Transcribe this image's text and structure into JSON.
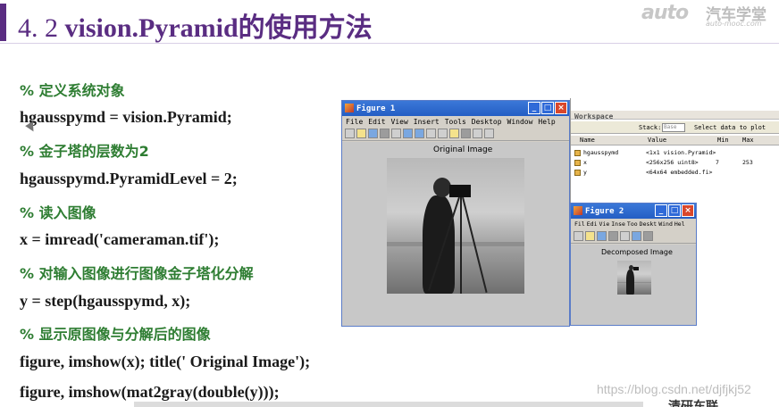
{
  "slide": {
    "title_num": "4. 2",
    "title_text": "vision.Pyramid的使用方法",
    "logo_mark": "auto",
    "logo_cn": "汽车学堂",
    "logo_en": "auto-mooc.com"
  },
  "code": [
    {
      "type": "comment",
      "text": "% 定义系统对象"
    },
    {
      "type": "code",
      "text": "hgausspymd = vision.Pyramid;"
    },
    {
      "type": "comment",
      "text": "% 金子塔的层数为2"
    },
    {
      "type": "code",
      "text": "hgausspymd.PyramidLevel = 2;"
    },
    {
      "type": "comment",
      "text": "% 读入图像"
    },
    {
      "type": "code",
      "text": "x = imread('cameraman.tif');"
    },
    {
      "type": "comment",
      "text": "% 对输入图像进行图像金子塔化分解"
    },
    {
      "type": "code",
      "text": "y = step(hgausspymd, x);"
    },
    {
      "type": "comment",
      "text": "% 显示原图像与分解后的图像"
    },
    {
      "type": "code",
      "text": "figure, imshow(x); title(' Original Image');"
    },
    {
      "type": "code",
      "text": "figure, imshow(mat2gray(double(y)));"
    }
  ],
  "figure1": {
    "title": "Figure 1",
    "menu": [
      "File",
      "Edit",
      "View",
      "Insert",
      "Tools",
      "Desktop",
      "Window",
      "Help"
    ],
    "caption": "Original Image"
  },
  "figure2": {
    "title": "Figure 2",
    "menu": [
      "Fil",
      "Edi",
      "Vie",
      "Inse",
      "Too",
      "Deskt",
      "Wind",
      "Hel"
    ],
    "caption": "Decomposed Image"
  },
  "workspace": {
    "title": "Workspace",
    "stack_label": "Stack:",
    "stack_value": "Base",
    "select_label": "Select data to plot",
    "columns": [
      "Name",
      "Value",
      "Min",
      "Max"
    ],
    "rows": [
      {
        "name": "hgausspymd",
        "value": "<1x1 vision.Pyramid>",
        "min": "",
        "max": ""
      },
      {
        "name": "x",
        "value": "<256x256 uint8>",
        "min": "7",
        "max": "253"
      },
      {
        "name": "y",
        "value": "<64x64 embedded.fi>",
        "min": "",
        "max": ""
      }
    ]
  },
  "footer": {
    "watermark": "https://blog.csdn.net/djfjkj52",
    "brand": "清研车联"
  }
}
